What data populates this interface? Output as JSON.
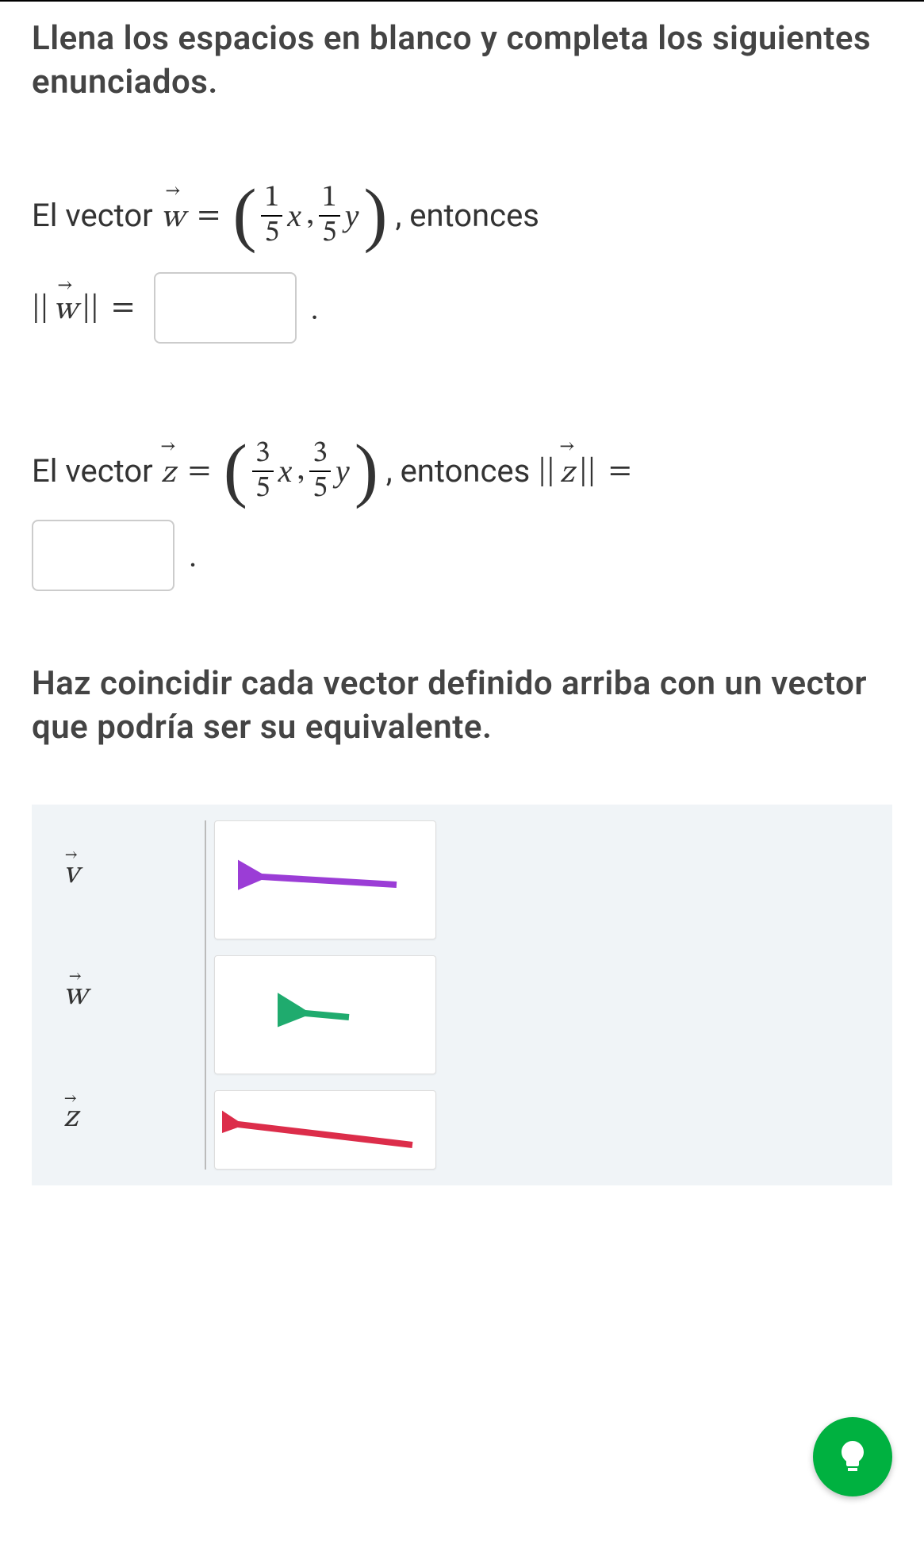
{
  "instruction1": "Llena los espacios en blanco y completa los siguientes enunciados.",
  "problem_w": {
    "prefix": "El vector ",
    "vector_var": "w",
    "equals": "=",
    "paren_l": "(",
    "frac1_num": "1",
    "frac1_den": "5",
    "var1": "x",
    "comma": ",",
    "frac2_num": "1",
    "frac2_den": "5",
    "var2": "y",
    "paren_r": ")",
    "suffix": ", entonces",
    "norm_open": "||",
    "norm_var": "w",
    "norm_close": "||",
    "norm_equals": "=",
    "period": "."
  },
  "problem_z": {
    "prefix": "El vector ",
    "vector_var": "z",
    "equals": "=",
    "paren_l": "(",
    "frac1_num": "3",
    "frac1_den": "5",
    "var1": "x",
    "comma": ",",
    "frac2_num": "3",
    "frac2_den": "5",
    "var2": "y",
    "paren_r": ")",
    "suffix": ", entonces ",
    "norm_open": "||",
    "norm_var": "z",
    "norm_close": "||",
    "norm_equals": "=",
    "period": "."
  },
  "instruction2": "Haz coincidir cada vector definido arriba con un vector que podría ser su equivalente.",
  "match": {
    "labels": [
      "v",
      "w",
      "z"
    ],
    "arrows": [
      {
        "color": "#9b3dd6",
        "length": "long",
        "angle": -5
      },
      {
        "color": "#1fab6e",
        "length": "short",
        "angle": -5
      },
      {
        "color": "#dc2d4a",
        "length": "long",
        "angle": 8
      }
    ]
  }
}
